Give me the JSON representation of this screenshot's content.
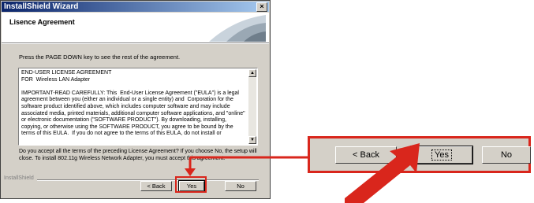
{
  "window": {
    "title": "InstallShield Wizard",
    "close_glyph": "×",
    "header_title": "Lisence Agreement"
  },
  "instruction": "Press the PAGE DOWN key to see the rest of the agreement.",
  "eula_text": "END-USER LICENSE AGREEMENT\nFOR  Wireless LAN Adapter\n\nIMPORTANT-READ CAREFULLY: This  End-User License Agreement (\"EULA\") is a legal agreement between you (either an individual or a single entity) and  Corporation for the software product identified above, which includes computer software and may include associated media, printed materials, additional computer software applications, and \"online\" or electronic documentation (\"SOFTWARE PRODUCT\"). By downloading, installing, copying, or otherwise using the SOFTWARE PRODUCT, you agree to be bound by the terms of this EULA.  If you do not agree to the terms of this EULA, do not install or",
  "scroll": {
    "up_glyph": "▲",
    "down_glyph": "▼"
  },
  "question": "Do you accept all the terms of the preceding License Agreement?  If you choose No, the setup will close.  To install 802.11g Wireless Network Adapter, you must accept this agreement.",
  "brand": "InstallShield",
  "buttons": {
    "back": "< Back",
    "yes": "Yes",
    "no": "No"
  },
  "zoom_buttons": {
    "back": "< Back",
    "yes": "Yes",
    "no": "No"
  },
  "colors": {
    "annotation": "#d9261c",
    "title_bar": "#0a246a",
    "dialog_face": "#d4d0c8"
  }
}
